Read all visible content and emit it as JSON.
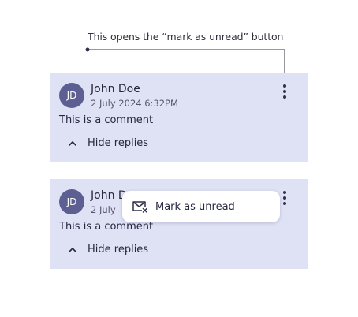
{
  "annotation": {
    "text": "This opens the “mark as unread” button"
  },
  "comments": [
    {
      "avatar_initials": "JD",
      "author": "John Doe",
      "timestamp": "2 July 2024 6:32PM",
      "text": "This is a comment",
      "toggle_label": "Hide replies"
    },
    {
      "avatar_initials": "JD",
      "author": "John D",
      "timestamp": "2 July",
      "text": "This is a comment",
      "toggle_label": "Hide replies"
    }
  ],
  "menu": {
    "items": [
      {
        "label": "Mark as unread",
        "icon": "mail-unread-icon"
      }
    ]
  },
  "colors": {
    "card_background": "#dfe1f5",
    "avatar": "#5d5f92",
    "text": "#26273f"
  }
}
